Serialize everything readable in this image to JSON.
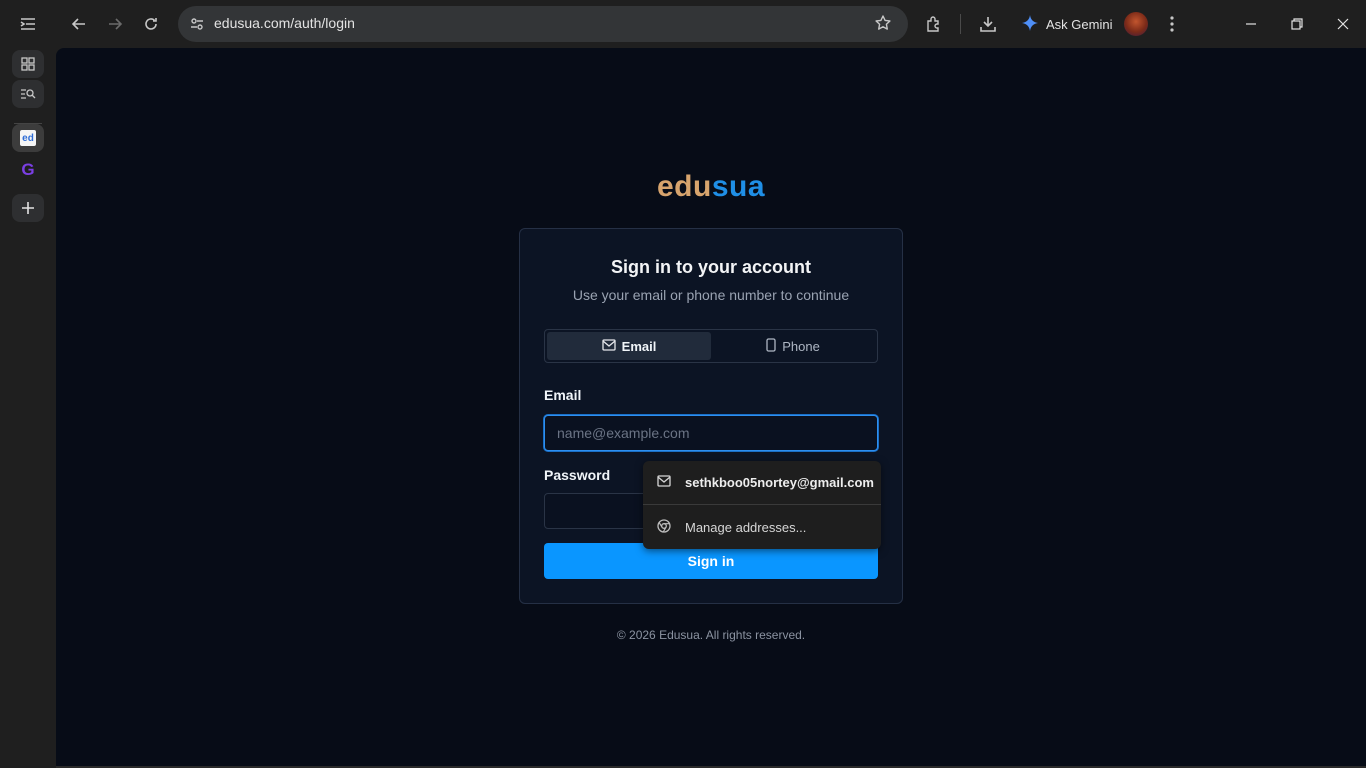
{
  "browser": {
    "url": "edusua.com/auth/login",
    "ask_gemini_label": "Ask Gemini"
  },
  "rail": {
    "tabs": [
      {
        "name": "edusua",
        "glyph": "ed"
      },
      {
        "name": "grammarly",
        "glyph": "G"
      }
    ]
  },
  "page": {
    "brand_part1": "edu",
    "brand_part2": "sua",
    "card": {
      "title": "Sign in to your account",
      "subtitle": "Use your email or phone number to continue",
      "tabs": {
        "email": "Email",
        "phone": "Phone"
      },
      "email_label": "Email",
      "email_placeholder": "name@example.com",
      "password_label": "Password",
      "signin_label": "Sign in"
    },
    "footer": "© 2026 Edusua. All rights reserved."
  },
  "autofill": {
    "suggestion": "sethkboo05nortey@gmail.com",
    "manage": "Manage addresses..."
  },
  "colors": {
    "brand_edu": "#d7a46d",
    "brand_sua": "#1f8fe6",
    "primary_button": "#0a96ff",
    "page_bg": "#070c17"
  }
}
